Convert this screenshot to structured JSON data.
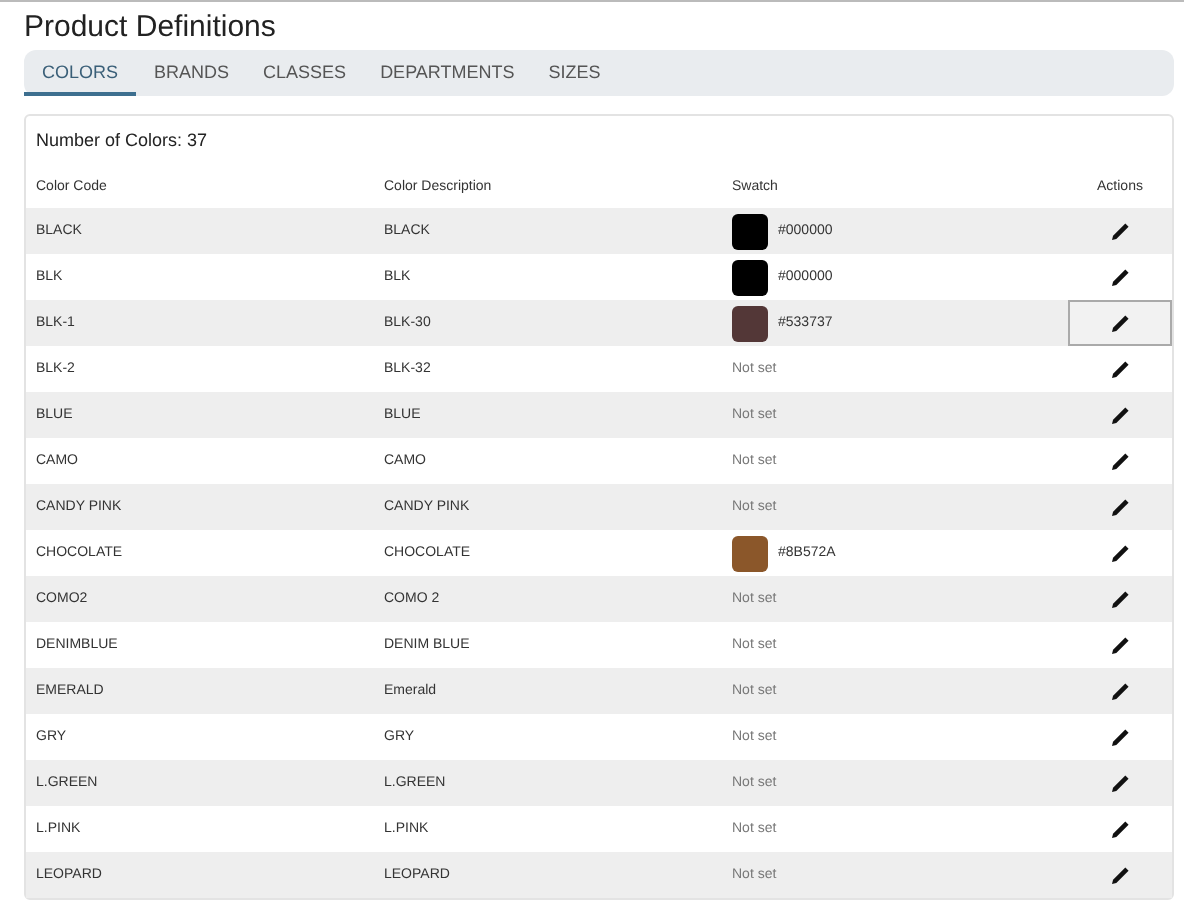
{
  "title": "Product Definitions",
  "tabs": [
    {
      "label": "COLORS",
      "selected": true
    },
    {
      "label": "BRANDS",
      "selected": false
    },
    {
      "label": "CLASSES",
      "selected": false
    },
    {
      "label": "DEPARTMENTS",
      "selected": false
    },
    {
      "label": "SIZES",
      "selected": false
    }
  ],
  "count": "Number of Colors: 37",
  "table": {
    "columns": [
      "Color Code",
      "Color Description",
      "Swatch",
      "Actions"
    ],
    "rows": [
      {
        "code": "BLACK",
        "description": "BLACK",
        "swatch": {
          "color": "#000000",
          "text": "#000000"
        },
        "focused": false
      },
      {
        "code": "BLK",
        "description": "BLK",
        "swatch": {
          "color": "#000000",
          "text": "#000000"
        },
        "focused": false
      },
      {
        "code": "BLK-1",
        "description": "BLK-30",
        "swatch": {
          "color": "#533737",
          "text": "#533737"
        },
        "focused": true
      },
      {
        "code": "BLK-2",
        "description": "BLK-32",
        "swatch": {
          "text": "Not set"
        },
        "focused": false
      },
      {
        "code": "BLUE",
        "description": "BLUE",
        "swatch": {
          "text": "Not set"
        },
        "focused": false
      },
      {
        "code": "CAMO",
        "description": "CAMO",
        "swatch": {
          "text": "Not set"
        },
        "focused": false
      },
      {
        "code": "CANDY PINK",
        "description": "CANDY PINK",
        "swatch": {
          "text": "Not set"
        },
        "focused": false
      },
      {
        "code": "CHOCOLATE",
        "description": "CHOCOLATE",
        "swatch": {
          "color": "#8b572a",
          "text": "#8B572A"
        },
        "focused": false
      },
      {
        "code": "COMO2",
        "description": "COMO 2",
        "swatch": {
          "text": "Not set"
        },
        "focused": false
      },
      {
        "code": "DENIMBLUE",
        "description": "DENIM BLUE",
        "swatch": {
          "text": "Not set"
        },
        "focused": false
      },
      {
        "code": "EMERALD",
        "description": "Emerald",
        "swatch": {
          "text": "Not set"
        },
        "focused": false
      },
      {
        "code": "GRY",
        "description": "GRY",
        "swatch": {
          "text": "Not set"
        },
        "focused": false
      },
      {
        "code": "L.GREEN",
        "description": "L.GREEN",
        "swatch": {
          "text": "Not set"
        },
        "focused": false
      },
      {
        "code": "L.PINK",
        "description": "L.PINK",
        "swatch": {
          "text": "Not set"
        },
        "focused": false
      },
      {
        "code": "LEOPARD",
        "description": "LEOPARD",
        "swatch": {
          "text": "Not set"
        },
        "focused": false
      }
    ]
  }
}
